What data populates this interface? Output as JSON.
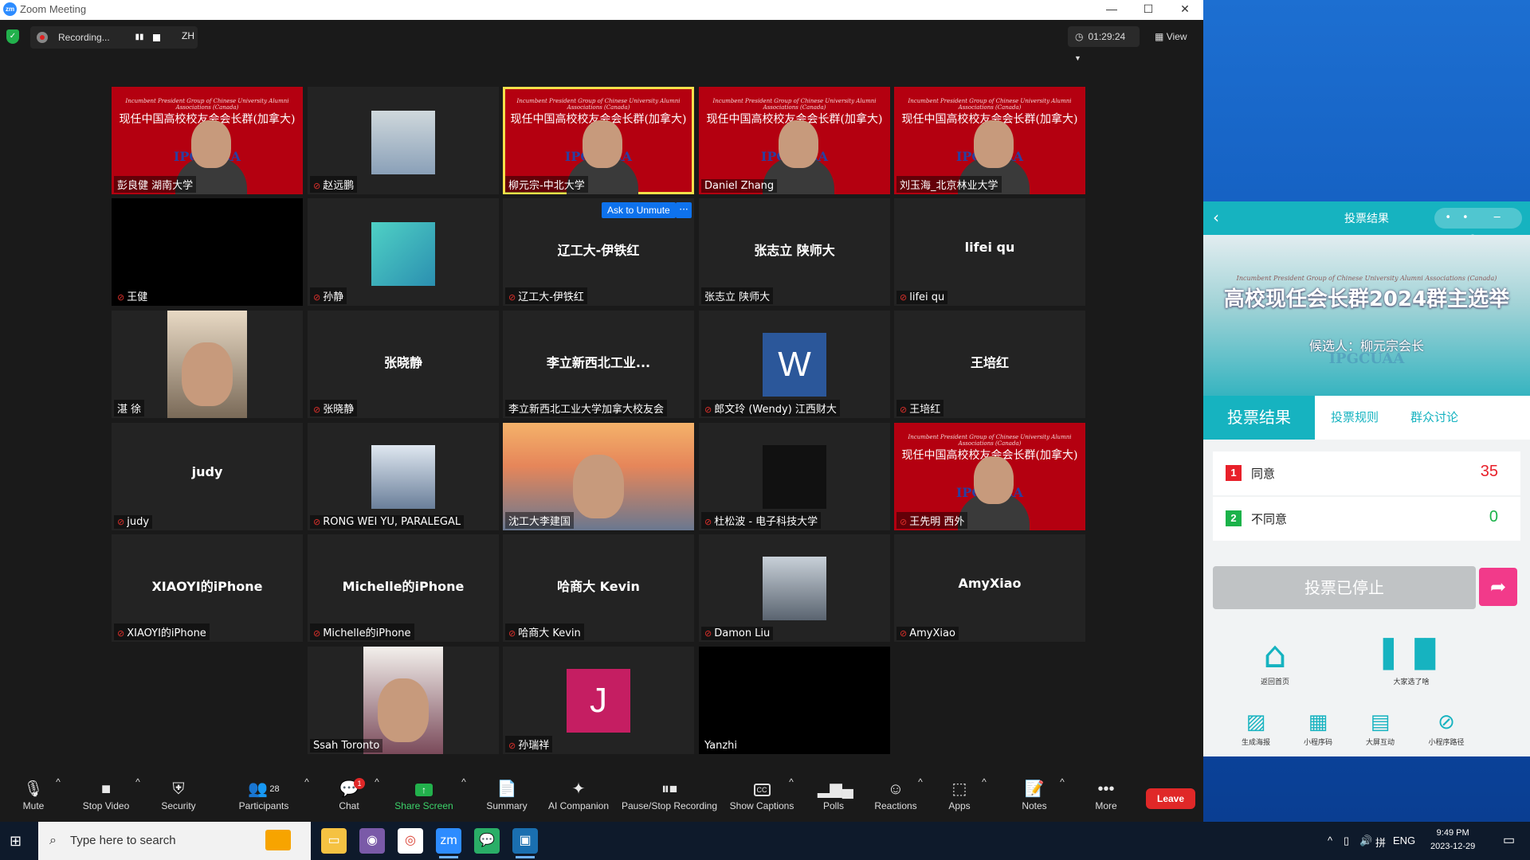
{
  "window": {
    "title": "Zoom Meeting",
    "min": "—",
    "max": "☐",
    "close": "✕"
  },
  "topbar": {
    "recording_text": "Recording...",
    "language": "ZH",
    "timer": "01:29:24",
    "view": "View"
  },
  "tiles": [
    {
      "name": "彭良健 湖南大学",
      "muted": false
    },
    {
      "name": "赵远鹏",
      "muted": true
    },
    {
      "name": "柳元宗-中北大学",
      "muted": false
    },
    {
      "name": "Daniel Zhang",
      "muted": false
    },
    {
      "name": "刘玉海_北京林业大学",
      "muted": false
    },
    {
      "name": "王健",
      "muted": true
    },
    {
      "name": "孙静",
      "muted": true
    },
    {
      "name": "辽工大-伊铁红",
      "muted": true,
      "center": "辽工大-伊铁红"
    },
    {
      "name": "张志立 陕师大",
      "muted": false,
      "center": "张志立 陕师大"
    },
    {
      "name": "lifei qu",
      "muted": true,
      "center": "lifei qu"
    },
    {
      "name": "湛 徐",
      "muted": false
    },
    {
      "name": "张晓静",
      "muted": true,
      "center": "张晓静"
    },
    {
      "name": "李立新西北工业大学加拿大校友会",
      "muted": false,
      "center": "李立新西北工业..."
    },
    {
      "name": "郎文玲 (Wendy) 江西财大",
      "muted": true
    },
    {
      "name": "王培红",
      "muted": true,
      "center": "王培红"
    },
    {
      "name": "judy",
      "muted": true,
      "center": "judy"
    },
    {
      "name": "RONG WEI YU, PARALEGAL",
      "muted": true
    },
    {
      "name": "沈工大李建国",
      "muted": false
    },
    {
      "name": "杜松波 - 电子科技大学",
      "muted": true
    },
    {
      "name": "王先明 西外",
      "muted": true
    },
    {
      "name": "XIAOYI的iPhone",
      "muted": true,
      "center": "XIAOYI的iPhone"
    },
    {
      "name": "Michelle的iPhone",
      "muted": true,
      "center": "Michelle的iPhone"
    },
    {
      "name": "哈商大 Kevin",
      "muted": true,
      "center": "哈商大 Kevin"
    },
    {
      "name": "Damon Liu",
      "muted": true
    },
    {
      "name": "AmyXiao",
      "muted": true,
      "center": "AmyXiao"
    },
    {
      "name": "Ssah Toronto",
      "muted": false
    },
    {
      "name": "孙瑞祥",
      "muted": true
    },
    {
      "name": "Yanzhi",
      "muted": false
    }
  ],
  "banner": {
    "english": "Incumbent President Group of Chinese University Alumni Associations (Canada)",
    "chinese": "现任中国高校校友会会长群(加拿大)",
    "logo": "IPGCUAA"
  },
  "avatars": {
    "w": "W",
    "j": "J"
  },
  "unmute": {
    "label": "Ask to Unmute",
    "more": "···"
  },
  "toolbar": {
    "mute": "Mute",
    "stop_video": "Stop Video",
    "security": "Security",
    "participants": "Participants",
    "participants_count": "28",
    "chat": "Chat",
    "chat_badge": "1",
    "share_screen": "Share Screen",
    "summary": "Summary",
    "ai_companion": "AI Companion",
    "pause_stop_recording": "Pause/Stop Recording",
    "show_captions": "Show Captions",
    "polls": "Polls",
    "reactions": "Reactions",
    "apps": "Apps",
    "notes": "Notes",
    "more": "More",
    "leave": "Leave"
  },
  "poll": {
    "header_title": "投票结果",
    "banner_sub": "Incumbent President Group of Chinese University Alumni Associations (Canada)",
    "banner_title": "高校现任会长群2024群主选举",
    "candidate": "候选人：柳元宗会长",
    "tabs": [
      "投票结果",
      "投票规则",
      "群众讨论"
    ],
    "options": [
      {
        "num": "1",
        "label": "同意",
        "count": "35",
        "color": "#e8202a"
      },
      {
        "num": "2",
        "label": "不同意",
        "count": "0",
        "color": "#1bb24a"
      }
    ],
    "stopped_label": "投票已停止",
    "icons": [
      {
        "label": "返回首页"
      },
      {
        "label": "大家选了啥"
      },
      {
        "label": "生成海报"
      },
      {
        "label": "小程序码"
      },
      {
        "label": "大屏互动"
      },
      {
        "label": "小程序路径"
      }
    ]
  },
  "taskbar": {
    "search_placeholder": "Type here to search",
    "lang": "ENG",
    "time": "9:49 PM",
    "date": "2023-12-29"
  }
}
